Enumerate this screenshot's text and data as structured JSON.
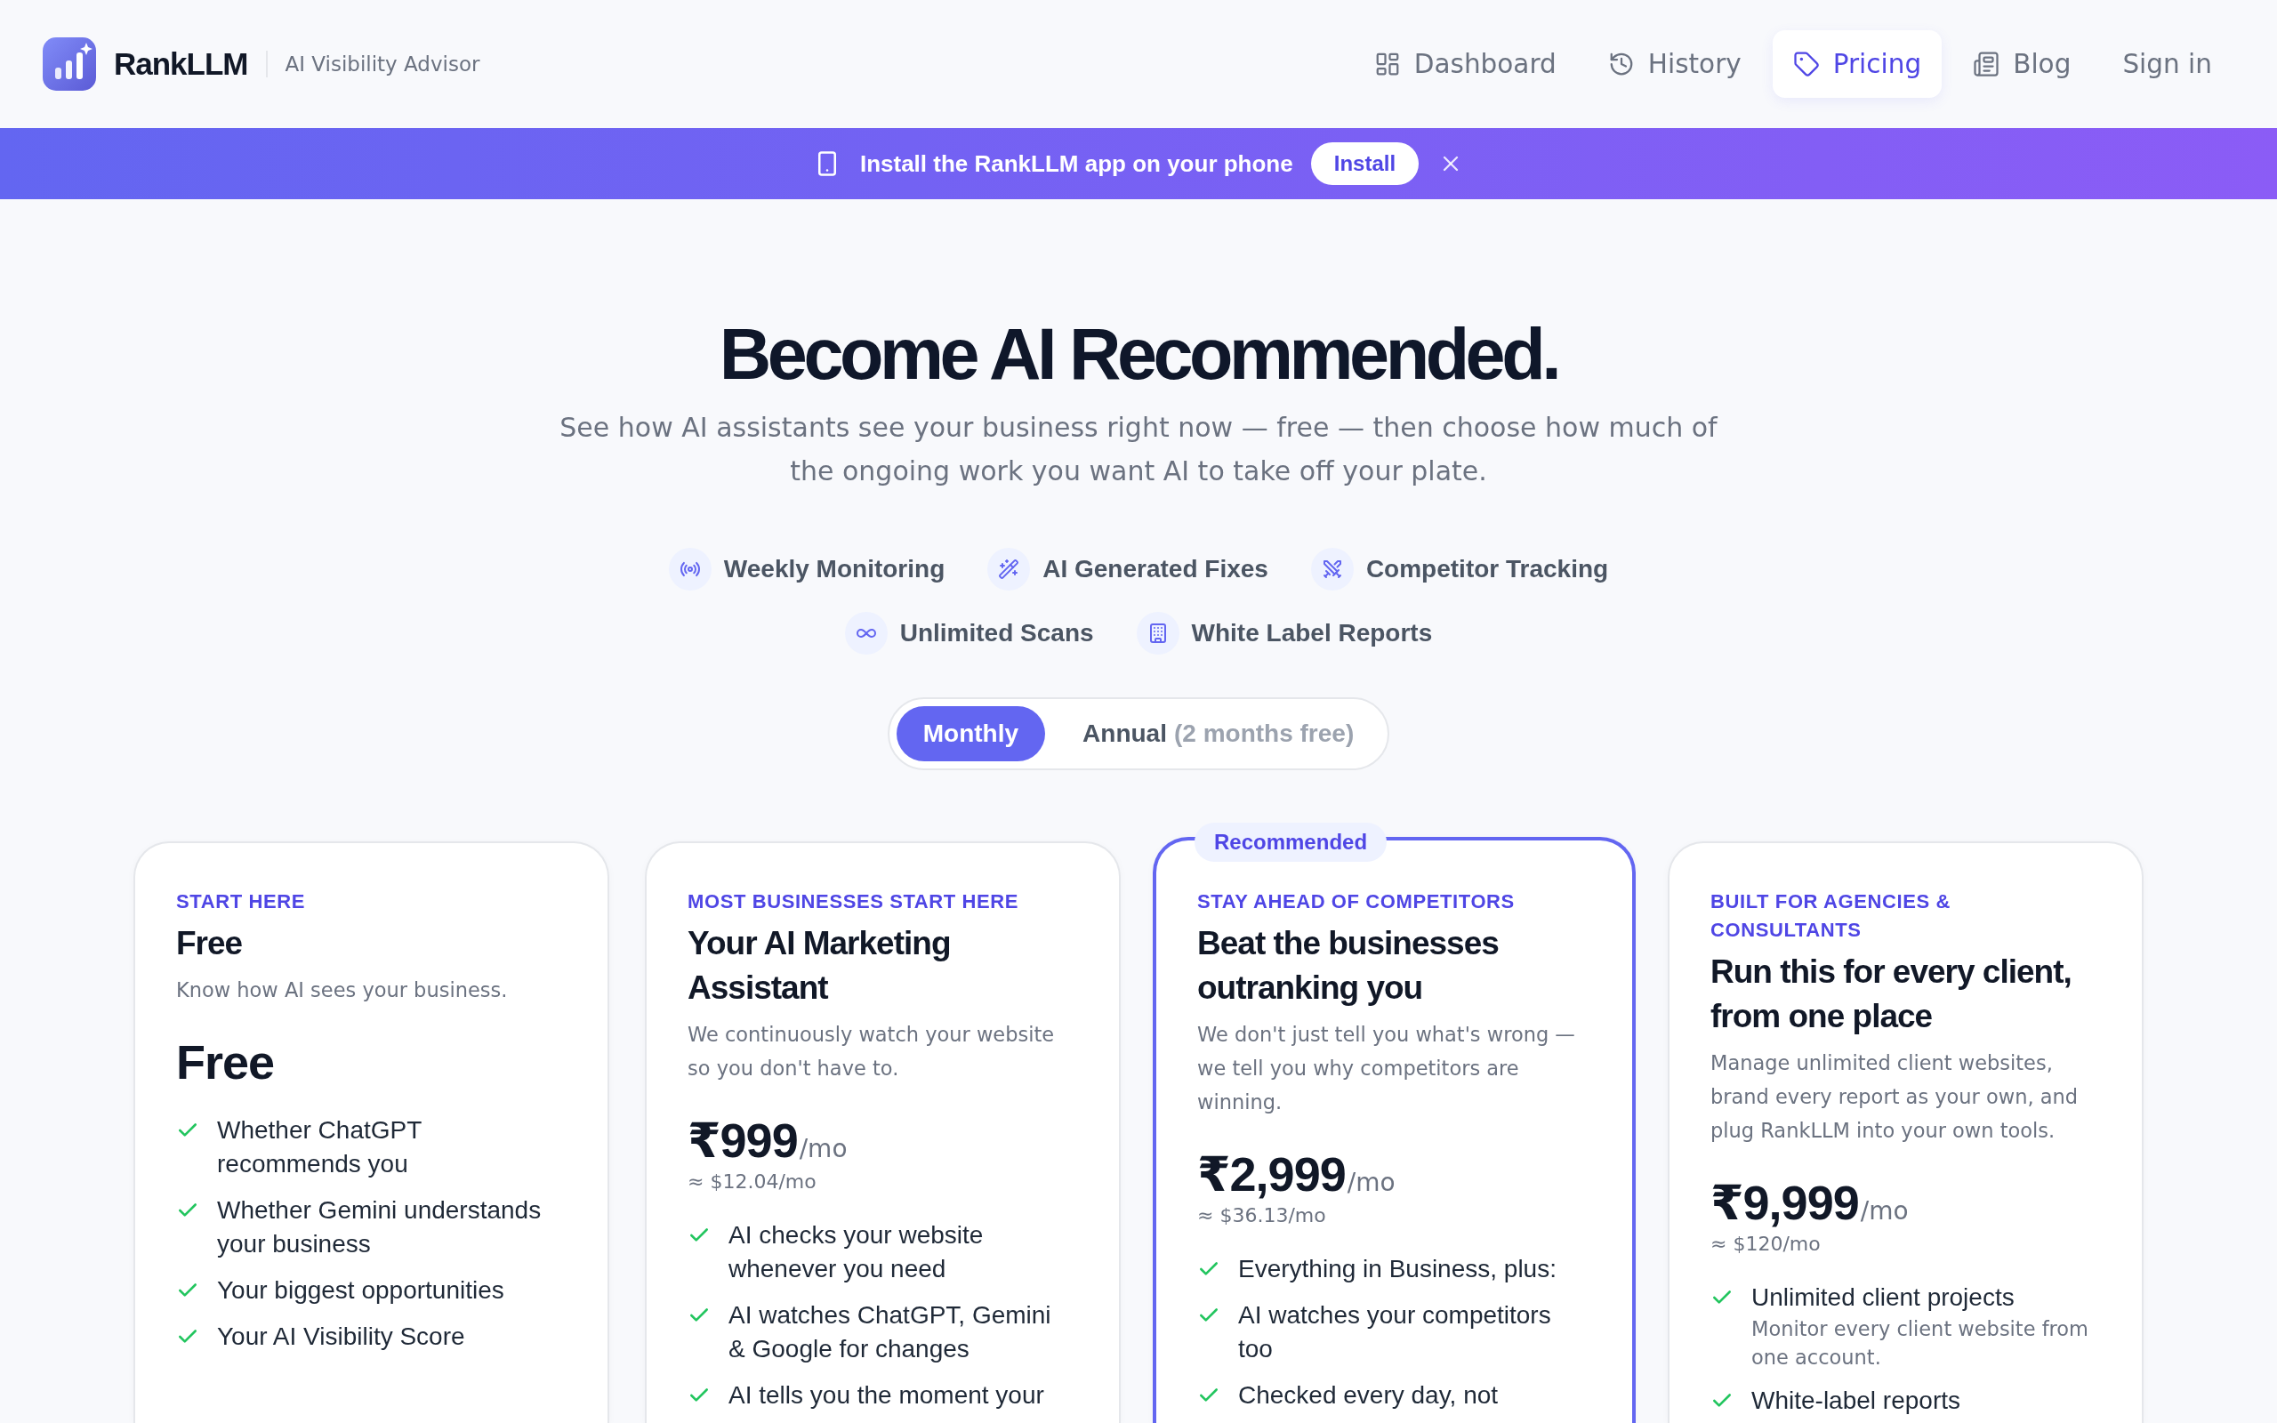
{
  "header": {
    "brand": "RankLLM",
    "tagline": "AI Visibility Advisor",
    "nav": [
      {
        "label": "Dashboard",
        "selected": false
      },
      {
        "label": "History",
        "selected": false
      },
      {
        "label": "Pricing",
        "selected": true
      },
      {
        "label": "Blog",
        "selected": false
      },
      {
        "label": "Sign in",
        "selected": false
      }
    ]
  },
  "banner": {
    "message": "Install the RankLLM app on your phone",
    "button": "Install"
  },
  "hero": {
    "title": "Become AI Recommended.",
    "subtitle": "See how AI assistants see your business right now — free — then choose how much of the ongoing work you want AI to take off your plate."
  },
  "highlights": [
    "Weekly Monitoring",
    "AI Generated Fixes",
    "Competitor Tracking",
    "Unlimited Scans",
    "White Label Reports"
  ],
  "billing": {
    "options": [
      {
        "label": "Monthly",
        "selected": true
      },
      {
        "label": "Annual",
        "note": "(2 months free)",
        "selected": false
      }
    ]
  },
  "plans": [
    {
      "eyebrow": "START HERE",
      "name": "Free",
      "description": "Know how AI sees your business.",
      "price": "Free",
      "featured": false,
      "features": [
        {
          "text": "Whether ChatGPT recommends you"
        },
        {
          "text": "Whether Gemini understands your business"
        },
        {
          "text": "Your biggest opportunities"
        },
        {
          "text": "Your AI Visibility Score"
        }
      ]
    },
    {
      "eyebrow": "MOST BUSINESSES START HERE",
      "name": "Your AI Marketing Assistant",
      "description": "We continuously watch your website so you don't have to.",
      "price": "₹999",
      "period": "/mo",
      "conversion": "≈ $12.04/mo",
      "featured": false,
      "features": [
        {
          "text": "AI checks your website whenever you need"
        },
        {
          "text": "AI watches ChatGPT, Gemini & Google for changes"
        },
        {
          "text": "AI tells you the moment your"
        }
      ]
    },
    {
      "badge": "Recommended",
      "eyebrow": "STAY AHEAD OF COMPETITORS",
      "name": "Beat the businesses outranking you",
      "description": "We don't just tell you what's wrong — we tell you why competitors are winning.",
      "price": "₹2,999",
      "period": "/mo",
      "conversion": "≈ $36.13/mo",
      "featured": true,
      "features": [
        {
          "text": "Everything in Business, plus:"
        },
        {
          "text": "AI watches your competitors too"
        },
        {
          "text": "Checked every day, not"
        }
      ]
    },
    {
      "eyebrow": "BUILT FOR AGENCIES & CONSULTANTS",
      "name": "Run this for every client, from one place",
      "description": "Manage unlimited client websites, brand every report as your own, and plug RankLLM into your own tools.",
      "price": "₹9,999",
      "period": "/mo",
      "conversion": "≈ $120/mo",
      "featured": false,
      "features": [
        {
          "text": "Unlimited client projects",
          "detail": "Monitor every client website from one account."
        },
        {
          "text": "White-label reports"
        }
      ]
    }
  ]
}
